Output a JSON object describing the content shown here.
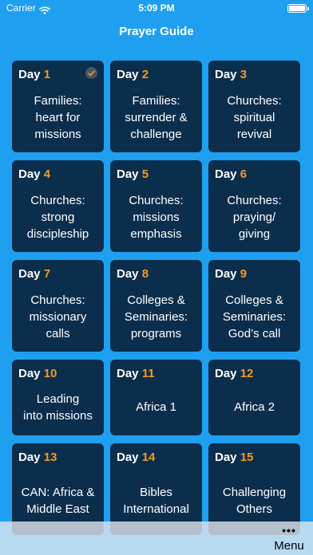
{
  "status_bar": {
    "carrier": "Carrier",
    "time": "5:09 PM"
  },
  "nav": {
    "title": "Prayer Guide"
  },
  "days": [
    {
      "prefix": "Day",
      "num": "1",
      "lines": [
        "Families:",
        "heart for",
        "missions"
      ],
      "completed": true
    },
    {
      "prefix": "Day",
      "num": "2",
      "lines": [
        "Families:",
        "surrender &",
        "challenge"
      ]
    },
    {
      "prefix": "Day",
      "num": "3",
      "lines": [
        "Churches:",
        "spiritual",
        "revival"
      ]
    },
    {
      "prefix": "Day",
      "num": "4",
      "lines": [
        "Churches:",
        "strong",
        "discipleship"
      ]
    },
    {
      "prefix": "Day",
      "num": "5",
      "lines": [
        "Churches:",
        "missions",
        "emphasis"
      ]
    },
    {
      "prefix": "Day",
      "num": "6",
      "lines": [
        "Churches:",
        "praying/",
        "giving"
      ]
    },
    {
      "prefix": "Day",
      "num": "7",
      "lines": [
        "Churches:",
        "missionary",
        "calls"
      ]
    },
    {
      "prefix": "Day",
      "num": "8",
      "lines": [
        "Colleges &",
        "Seminaries:",
        "programs"
      ]
    },
    {
      "prefix": "Day",
      "num": "9",
      "lines": [
        "Colleges &",
        "Seminaries:",
        "God’s call"
      ]
    },
    {
      "prefix": "Day",
      "num": "10",
      "lines": [
        "Leading",
        "into missions"
      ],
      "short": true
    },
    {
      "prefix": "Day",
      "num": "11",
      "lines": [
        "Africa 1"
      ],
      "short": true
    },
    {
      "prefix": "Day",
      "num": "12",
      "lines": [
        "Africa 2"
      ],
      "short": true
    },
    {
      "prefix": "Day",
      "num": "13",
      "lines": [
        "CAN: Africa &",
        "Middle East"
      ]
    },
    {
      "prefix": "Day",
      "num": "14",
      "lines": [
        "Bibles",
        "International"
      ]
    },
    {
      "prefix": "Day",
      "num": "15",
      "lines": [
        "Challenging",
        "Others"
      ]
    }
  ],
  "toolbar": {
    "ellipsis": "•••",
    "menu_label": "Menu"
  }
}
